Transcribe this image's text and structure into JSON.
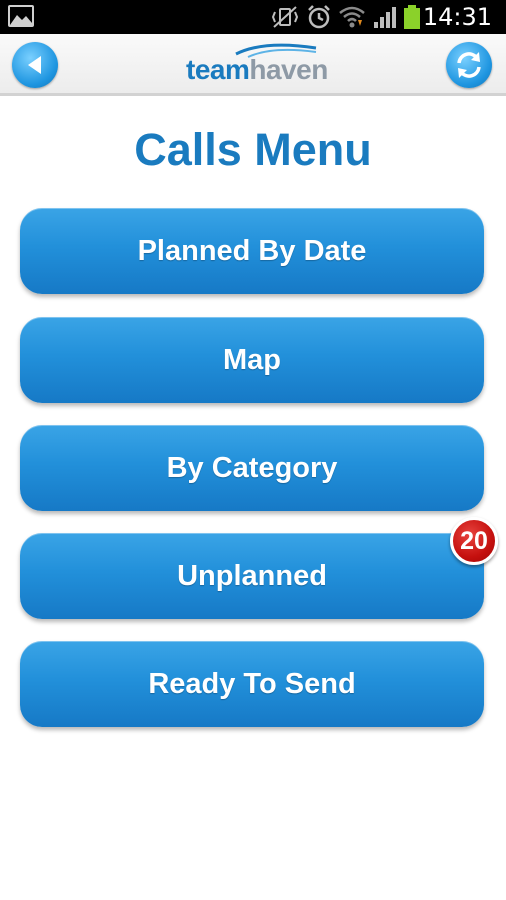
{
  "status_bar": {
    "time": "14:31",
    "icons": [
      "image-icon",
      "vibrate-off-icon",
      "alarm-icon",
      "wifi-icon",
      "signal-icon",
      "battery-icon"
    ]
  },
  "app_bar": {
    "logo_part1": "team",
    "logo_part2": "haven",
    "back_icon": "back-arrow-icon",
    "refresh_icon": "refresh-icon"
  },
  "page": {
    "title": "Calls Menu"
  },
  "menu": {
    "items": [
      {
        "label": "Planned By Date"
      },
      {
        "label": "Map"
      },
      {
        "label": "By Category"
      },
      {
        "label": "Unplanned",
        "badge": "20"
      },
      {
        "label": "Ready To Send"
      }
    ]
  },
  "colors": {
    "brand_blue": "#1a7bbf",
    "button_blue": "#2290da",
    "badge_red": "#c5100e",
    "logo_gray": "#8e9aa6"
  }
}
